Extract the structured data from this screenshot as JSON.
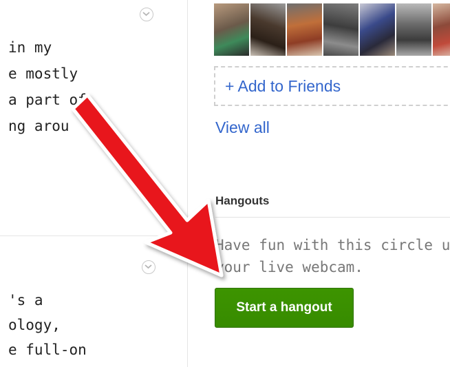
{
  "post1": {
    "lines": "in my\ne mostly\na part of\nng arou"
  },
  "post2": {
    "lines": "'s a\nology,\ne full-on"
  },
  "friends": {
    "add_label": "+ Add to Friends",
    "view_all_label": "View all"
  },
  "hangouts": {
    "title": "Hangouts",
    "description": "Have fun with this circle using\nyour live webcam.",
    "button_label": "Start a hangout"
  },
  "colors": {
    "link": "#3366cc",
    "button_green": "#3d9400",
    "arrow_red": "#e8191c"
  },
  "icons": {
    "post_menu": "chevron-down-icon",
    "annotation": "red-arrow-icon"
  }
}
